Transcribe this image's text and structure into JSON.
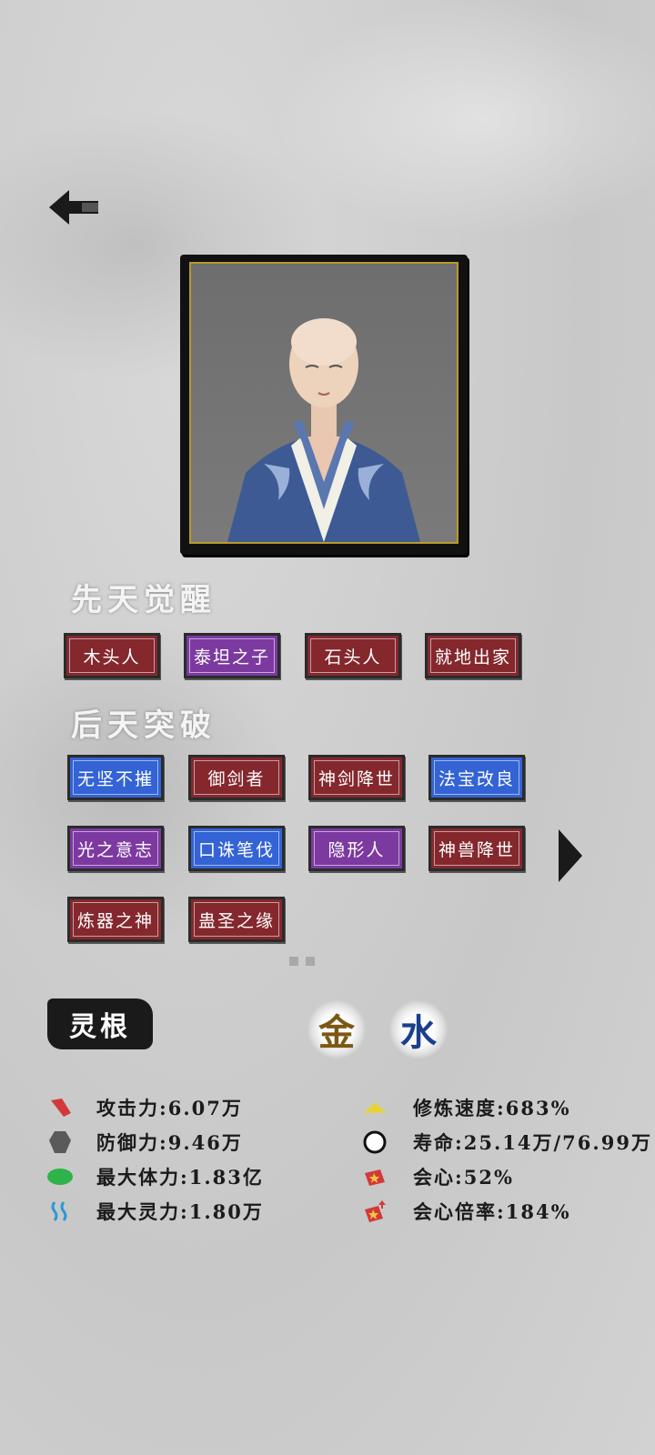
{
  "nav": {
    "back_icon": "back-arrow-icon"
  },
  "sections": {
    "innate_title": "先天觉醒",
    "acquired_title": "后天突破"
  },
  "innate_tags": [
    {
      "label": "木头人",
      "color": "red"
    },
    {
      "label": "泰坦之子",
      "color": "purple"
    },
    {
      "label": "石头人",
      "color": "red"
    },
    {
      "label": "就地出家",
      "color": "red"
    }
  ],
  "acquired_tags": [
    {
      "label": "无坚不摧",
      "color": "blue"
    },
    {
      "label": "御剑者",
      "color": "red"
    },
    {
      "label": "神剑降世",
      "color": "red"
    },
    {
      "label": "法宝改良",
      "color": "blue"
    },
    {
      "label": "光之意志",
      "color": "purple"
    },
    {
      "label": "口诛笔伐",
      "color": "blue"
    },
    {
      "label": "隐形人",
      "color": "purple"
    },
    {
      "label": "神兽降世",
      "color": "red"
    },
    {
      "label": "炼器之神",
      "color": "red"
    },
    {
      "label": "蛊圣之缘",
      "color": "red"
    }
  ],
  "spirit_root": {
    "label": "灵根",
    "elements": [
      {
        "char": "金",
        "color": "#7a5a12"
      },
      {
        "char": "水",
        "color": "#1a3f8c"
      }
    ]
  },
  "stats_left": [
    {
      "text": "攻击力:6.07万",
      "icon": "attack-icon",
      "color": "#d23a3a"
    },
    {
      "text": "防御力:9.46万",
      "icon": "defense-icon",
      "color": "#5a5a5a"
    },
    {
      "text": "最大体力:1.83亿",
      "icon": "stamina-icon",
      "color": "#2db34a"
    },
    {
      "text": "最大灵力:1.80万",
      "icon": "spirit-icon",
      "color": "#2a9ad6"
    }
  ],
  "stats_right": [
    {
      "text": "修炼速度:683%",
      "icon": "cultivation-speed-icon",
      "color": "#e6d33a"
    },
    {
      "text": "寿命:25.14万/76.99万",
      "icon": "lifespan-icon",
      "color": "#111111"
    },
    {
      "text": "会心:52%",
      "icon": "critical-icon",
      "color": "#d23a3a"
    },
    {
      "text": "会心倍率:184%",
      "icon": "critical-multiplier-icon",
      "color": "#d23a3a"
    }
  ]
}
